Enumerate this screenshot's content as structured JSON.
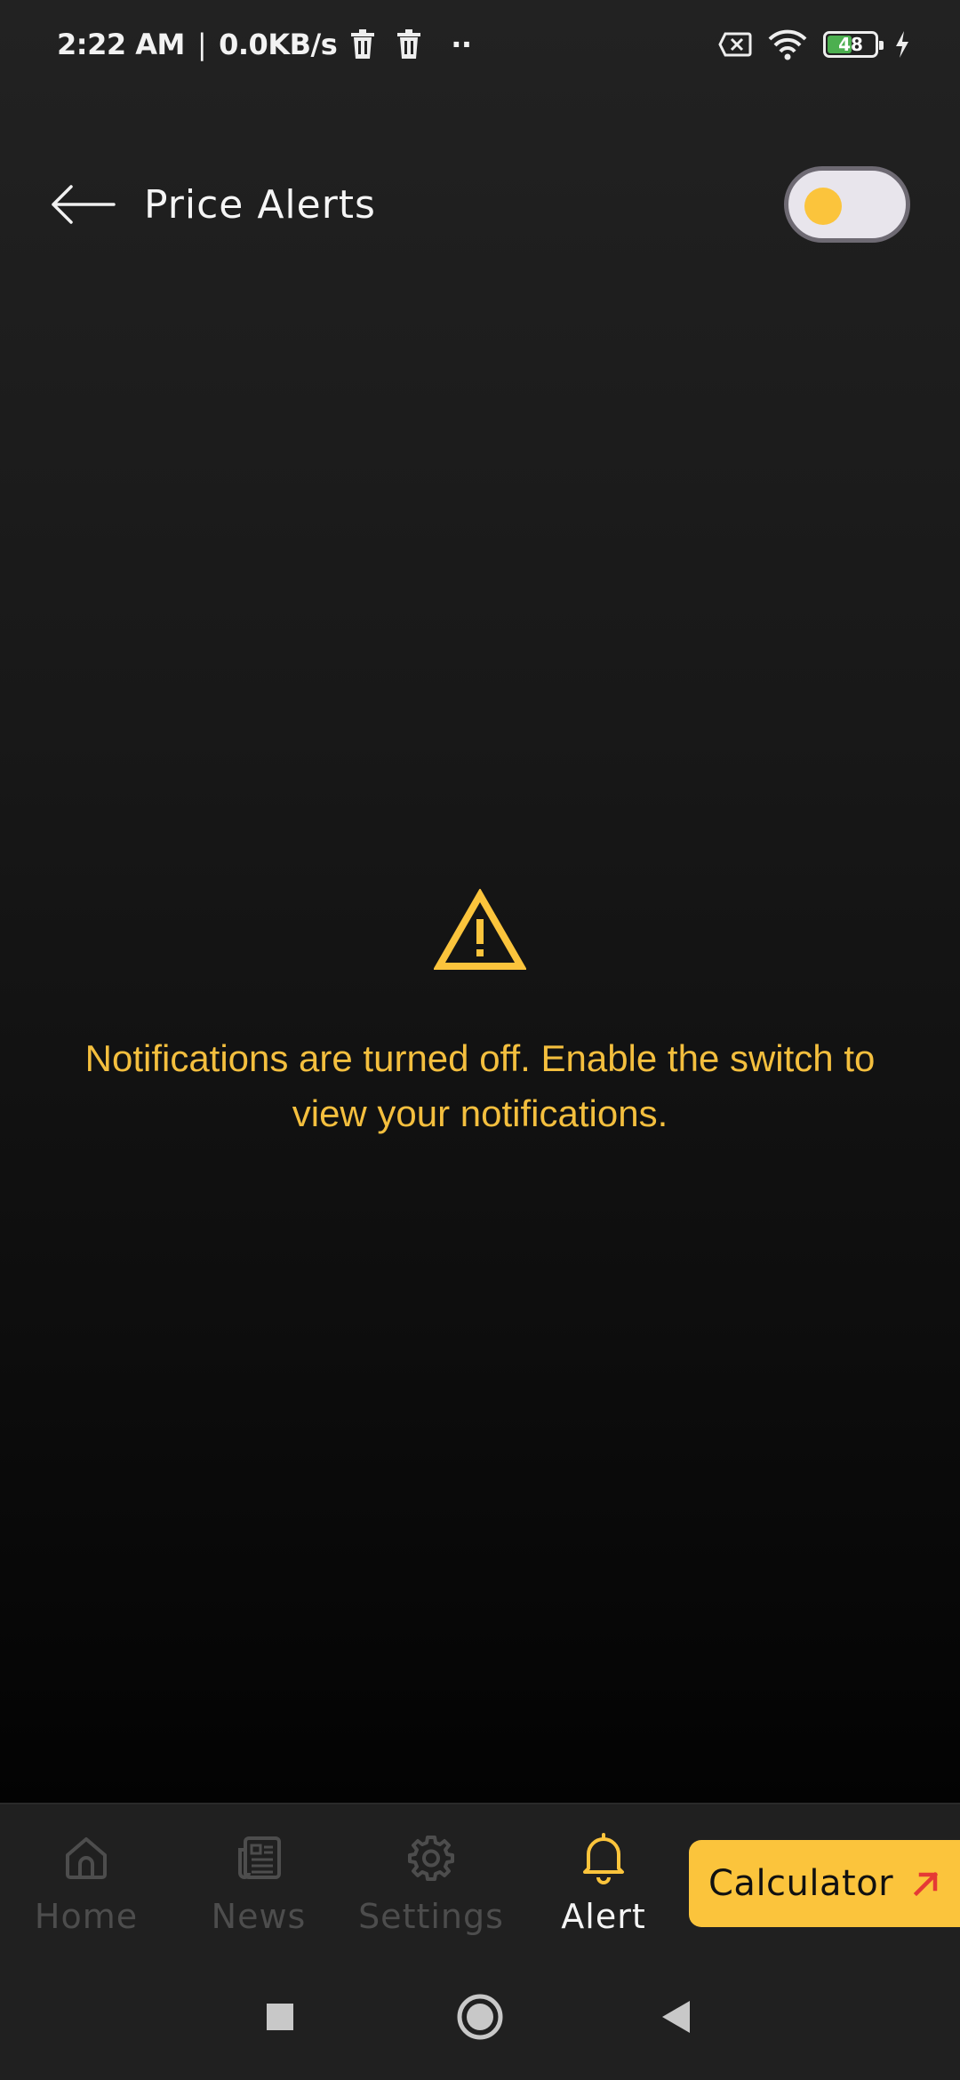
{
  "status_bar": {
    "time": "2:22 AM",
    "separator": "|",
    "network_speed": "0.0KB/s",
    "dots": "··",
    "battery_level": "48",
    "battery_fraction": 0.48
  },
  "header": {
    "title": "Price Alerts",
    "toggle_state": "off"
  },
  "empty_state": {
    "message": "Notifications are turned off. Enable the switch to view your notifications."
  },
  "bottom_nav": {
    "items": [
      {
        "label": "Home",
        "icon": "home-icon",
        "active": false
      },
      {
        "label": "News",
        "icon": "news-icon",
        "active": false
      },
      {
        "label": "Settings",
        "icon": "gear-icon",
        "active": false
      },
      {
        "label": "Alert",
        "icon": "bell-icon",
        "active": true
      }
    ],
    "calculator_label": "Calculator"
  },
  "colors": {
    "accent": "#fbc43c",
    "message": "#f4bf3e",
    "inactive_nav": "#4d4d4d",
    "arrow": "#e53935"
  }
}
